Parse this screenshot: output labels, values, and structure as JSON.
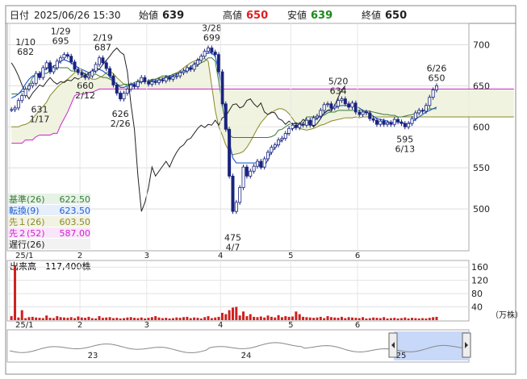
{
  "header": {
    "date_label": "日付",
    "datetime": "2025/06/26 15:30",
    "open_label": "始値",
    "open": "639",
    "high_label": "高値",
    "high": "650",
    "low_label": "安値",
    "low": "639",
    "close_label": "終値",
    "close": "650",
    "colors": {
      "high": "#e02020",
      "low": "#1a8a1a",
      "open": "#222222",
      "close": "#222222"
    }
  },
  "legend": [
    {
      "label": "基準(26)",
      "value": "622.50",
      "color": "#3a7a3a",
      "bg": "#e6f2e6"
    },
    {
      "label": "転換(9)",
      "value": "623.50",
      "color": "#2060d0",
      "bg": "#e6eefc"
    },
    {
      "label": "先１(26)",
      "value": "603.50",
      "color": "#8a8a2a",
      "bg": "#f2f2e2"
    },
    {
      "label": "先２(52)",
      "value": "587.00",
      "color": "#d020d0",
      "bg": "#fae6fa"
    },
    {
      "label": "遅行(26)",
      "value": "",
      "color": "#222222",
      "bg": "#f2f2f2"
    }
  ],
  "volume_title": "出来高　117,400株",
  "volume_unit": "（万株）",
  "chart_data": [
    {
      "type": "candlestick",
      "title": "",
      "y_ticks": [
        500,
        550,
        600,
        650,
        700
      ],
      "ylim": [
        450,
        725
      ],
      "x_month_labels": [
        "25/1",
        "2",
        "3",
        "4",
        "5",
        "6"
      ],
      "x_month_start_index": [
        0,
        20,
        39,
        60,
        80,
        99
      ],
      "annotations": [
        {
          "text": [
            "1/10",
            "682"
          ],
          "index": 4,
          "price": 682,
          "side": "above"
        },
        {
          "text": [
            "1/29",
            "695"
          ],
          "index": 14,
          "price": 695,
          "side": "above"
        },
        {
          "text": [
            "2/19",
            "687"
          ],
          "index": 26,
          "price": 687,
          "side": "above"
        },
        {
          "text": [
            "3/28",
            "699"
          ],
          "index": 57,
          "price": 699,
          "side": "above"
        },
        {
          "text": [
            "660",
            "2/12"
          ],
          "index": 21,
          "price": 660,
          "side": "below"
        },
        {
          "text": [
            "631",
            "1/17"
          ],
          "index": 8,
          "price": 631,
          "side": "below"
        },
        {
          "text": [
            "626",
            "2/26"
          ],
          "index": 31,
          "price": 626,
          "side": "below"
        },
        {
          "text": [
            "5/20",
            "634"
          ],
          "index": 93,
          "price": 634,
          "side": "above"
        },
        {
          "text": [
            "475",
            "4/7"
          ],
          "index": 63,
          "price": 475,
          "side": "below"
        },
        {
          "text": [
            "595",
            "6/13"
          ],
          "index": 112,
          "price": 595,
          "side": "below"
        },
        {
          "text": [
            "6/26",
            "650"
          ],
          "index": 121,
          "price": 650,
          "side": "above"
        }
      ],
      "candles_close": [
        621,
        623,
        632,
        638,
        646,
        650,
        653,
        665,
        660,
        672,
        678,
        667,
        672,
        680,
        684,
        688,
        686,
        679,
        670,
        666,
        663,
        660,
        662,
        668,
        676,
        684,
        678,
        671,
        662,
        651,
        641,
        634,
        641,
        646,
        651,
        649,
        655,
        660,
        655,
        652,
        655,
        654,
        657,
        656,
        660,
        658,
        661,
        662,
        666,
        668,
        672,
        670,
        676,
        681,
        686,
        692,
        696,
        691,
        688,
        667,
        628,
        597,
        540,
        497,
        508,
        526,
        551,
        540,
        546,
        552,
        558,
        551,
        561,
        569,
        575,
        578,
        584,
        586,
        592,
        598,
        602,
        599,
        603,
        602,
        608,
        602,
        611,
        613,
        620,
        627,
        628,
        623,
        625,
        632,
        634,
        628,
        624,
        629,
        618,
        615,
        618,
        617,
        610,
        608,
        603,
        607,
        603,
        605,
        603,
        609,
        606,
        604,
        600,
        604,
        610,
        617,
        620,
        619,
        626,
        636,
        645,
        650
      ],
      "ichimoku_label_note": "lines drawn from indicator arrays",
      "kijun": [
        640,
        640,
        640,
        643,
        643,
        650,
        660,
        663,
        663,
        665,
        665,
        668,
        668,
        672,
        672,
        672,
        672,
        668,
        668,
        668,
        666,
        664,
        664,
        664,
        664,
        662,
        660,
        660,
        658,
        656,
        652,
        650,
        652,
        652,
        652,
        654,
        656,
        656,
        656,
        656,
        658,
        658,
        660,
        662,
        662,
        662,
        664,
        665,
        666,
        666,
        668,
        670,
        672,
        675,
        678,
        680,
        684,
        684,
        680,
        655,
        625,
        604,
        590,
        587,
        587,
        587,
        587,
        587,
        587,
        587,
        587,
        587,
        587,
        587,
        588,
        590,
        596,
        597,
        600,
        603,
        604,
        604,
        604,
        604,
        612,
        612,
        612,
        612,
        614,
        614,
        617,
        618,
        618,
        620,
        620,
        620,
        620,
        620,
        620,
        620,
        620,
        619,
        619,
        618,
        617,
        616,
        615,
        615,
        614,
        614,
        612,
        612,
        613,
        614,
        615,
        616,
        618,
        620,
        621,
        622,
        622,
        622
      ],
      "tenkan": [
        635,
        637,
        640,
        645,
        652,
        658,
        662,
        663,
        665,
        668,
        671,
        672,
        674,
        676,
        680,
        682,
        680,
        678,
        675,
        672,
        670,
        668,
        666,
        666,
        668,
        670,
        668,
        665,
        662,
        656,
        652,
        648,
        648,
        650,
        652,
        652,
        653,
        655,
        655,
        655,
        656,
        656,
        657,
        658,
        660,
        661,
        662,
        664,
        666,
        668,
        670,
        673,
        676,
        680,
        684,
        688,
        690,
        690,
        686,
        668,
        640,
        612,
        582,
        562,
        556,
        556,
        556,
        556,
        556,
        556,
        556,
        550,
        552,
        560,
        570,
        574,
        580,
        584,
        588,
        594,
        598,
        600,
        602,
        602,
        605,
        605,
        608,
        610,
        613,
        616,
        620,
        622,
        623,
        625,
        626,
        626,
        626,
        626,
        625,
        623,
        620,
        618,
        616,
        613,
        610,
        609,
        608,
        607,
        605,
        606,
        606,
        605,
        604,
        604,
        606,
        609,
        612,
        615,
        618,
        620,
        622,
        624
      ],
      "senkou1": [
        600,
        600,
        600,
        602,
        603,
        605,
        610,
        615,
        620,
        625,
        630,
        638,
        643,
        648,
        652,
        655,
        658,
        662,
        666,
        670,
        668,
        664,
        660,
        658,
        658,
        660,
        662,
        666,
        668,
        665,
        660,
        656,
        652,
        650,
        650,
        652,
        653,
        655,
        656,
        655,
        657,
        658,
        659,
        660,
        661,
        662,
        664,
        666,
        668,
        672,
        675,
        678,
        680,
        682,
        683,
        683,
        680,
        650,
        620,
        600,
        590,
        578,
        570,
        566,
        567,
        568,
        570,
        575,
        582,
        590,
        598,
        605,
        610,
        615,
        617,
        620,
        622,
        622,
        620,
        616,
        610,
        604,
        598,
        597,
        596,
        597,
        598,
        600,
        602,
        603,
        605,
        607,
        608,
        609,
        610,
        611,
        611,
        611,
        612,
        611,
        612,
        612,
        612,
        612,
        612,
        612,
        612,
        612,
        612,
        612,
        612,
        612,
        612,
        612,
        612,
        612,
        612,
        612,
        612,
        612,
        612,
        612,
        612,
        612,
        612,
        612,
        612,
        612,
        612,
        612,
        612,
        612,
        612,
        612,
        612,
        612,
        612,
        612,
        612,
        612,
        612,
        612,
        612,
        612
      ],
      "senkou2": [
        580,
        580,
        580,
        580,
        584,
        584,
        584,
        588,
        590,
        590,
        590,
        590,
        592,
        592,
        602,
        610,
        618,
        628,
        638,
        640,
        640,
        640,
        642,
        642,
        644,
        646,
        646,
        646,
        646,
        646,
        646,
        646,
        646,
        646,
        646,
        646,
        646,
        646,
        646,
        646,
        646,
        646,
        646,
        646,
        646,
        646,
        646,
        646,
        646,
        646,
        646,
        646,
        646,
        646,
        646,
        646,
        646,
        646,
        646,
        646,
        646,
        646,
        646,
        646,
        646,
        646,
        646,
        646,
        646,
        646,
        646,
        646,
        646,
        646,
        646,
        646,
        646,
        646,
        646,
        646,
        646,
        646,
        646,
        646,
        646,
        646,
        646,
        646,
        646,
        646,
        646,
        646,
        646,
        646,
        646,
        646,
        646,
        646,
        646,
        646,
        646,
        646,
        646,
        646,
        646,
        646,
        646,
        646,
        646,
        646,
        646,
        646,
        646,
        646,
        646,
        646,
        646,
        646,
        646,
        646,
        646,
        646,
        646,
        646,
        646,
        646,
        646,
        646,
        646,
        646,
        646,
        646,
        646,
        646,
        646,
        646,
        646,
        646,
        646,
        646
      ],
      "volume_y_ticks": [
        40,
        80,
        120,
        160
      ],
      "volume_ylim": [
        0,
        180
      ],
      "volume_max_note": "tallest bar near Jan 2",
      "volume_values": [
        12,
        165,
        8,
        30,
        6,
        9,
        10,
        8,
        7,
        6,
        14,
        7,
        6,
        12,
        9,
        8,
        7,
        9,
        6,
        11,
        8,
        7,
        10,
        6,
        5,
        12,
        7,
        8,
        9,
        6,
        7,
        5,
        6,
        8,
        9,
        7,
        6,
        8,
        5,
        7,
        9,
        12,
        8,
        6,
        7,
        5,
        6,
        8,
        7,
        9,
        10,
        6,
        8,
        7,
        5,
        9,
        12,
        6,
        8,
        10,
        22,
        18,
        30,
        38,
        40,
        14,
        26,
        12,
        18,
        10,
        9,
        11,
        8,
        14,
        10,
        8,
        15,
        9,
        12,
        10,
        11,
        26,
        18,
        10,
        9,
        8,
        7,
        8,
        10,
        6,
        12,
        9,
        8,
        7,
        10,
        6,
        9,
        8,
        7,
        6,
        9,
        5,
        6,
        8,
        7,
        6,
        9,
        5,
        6,
        7,
        5,
        6,
        8,
        5,
        7,
        6,
        5,
        6,
        5,
        7,
        9,
        10,
        6
      ]
    },
    {
      "type": "area",
      "title": "",
      "x_labels": [
        "23",
        "24",
        "25"
      ],
      "note": "navigator overview"
    }
  ]
}
